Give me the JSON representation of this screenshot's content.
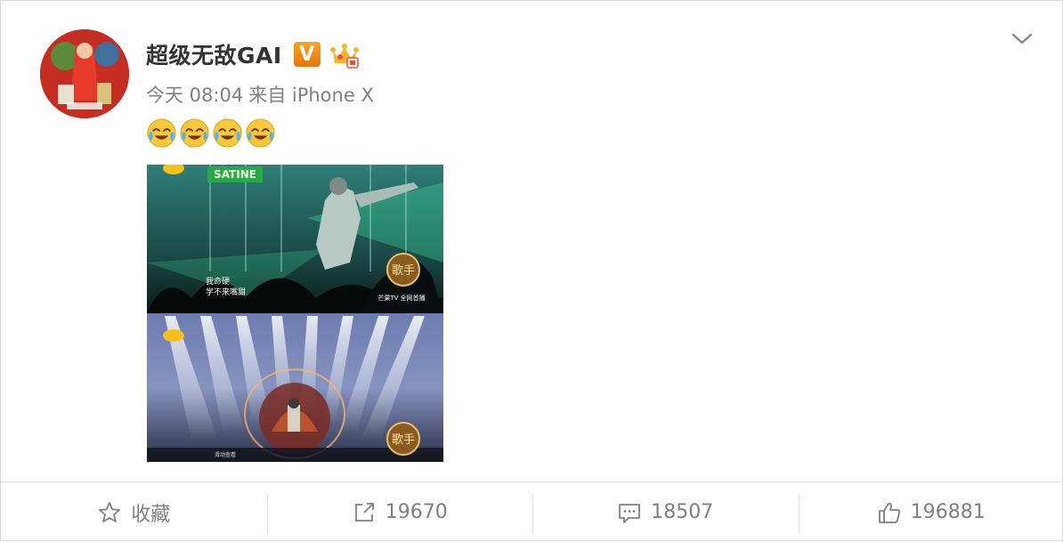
{
  "post": {
    "user": {
      "name": "超级无敌GAI",
      "verified_badge": "V",
      "crown_icon": "crown-icon"
    },
    "meta": {
      "time": "今天 08:04",
      "source": "来自 iPhone X"
    },
    "emojis": [
      "laugh-cry-emoji",
      "laugh-cry-emoji",
      "laugh-cry-emoji",
      "laugh-cry-emoji"
    ],
    "media": {
      "top_caption_line1": "我命硬",
      "top_caption_line2": "学不来嘴甜",
      "top_sign": "SATINE",
      "top_watermark": "芒果TV 全网首播",
      "show_logo_top": "歌手",
      "show_logo_bottom": "歌手",
      "bottom_small_text": "滑动查看"
    }
  },
  "actions": {
    "favorite": {
      "label": "收藏",
      "icon": "star-icon"
    },
    "repost": {
      "count": "19670",
      "icon": "share-icon"
    },
    "comment": {
      "count": "18507",
      "icon": "comment-icon"
    },
    "like": {
      "count": "196881",
      "icon": "thumbs-up-icon"
    }
  },
  "colors": {
    "badge_orange": "#f08a1b",
    "text_gray": "#808080",
    "divider": "#e6e6e6"
  }
}
